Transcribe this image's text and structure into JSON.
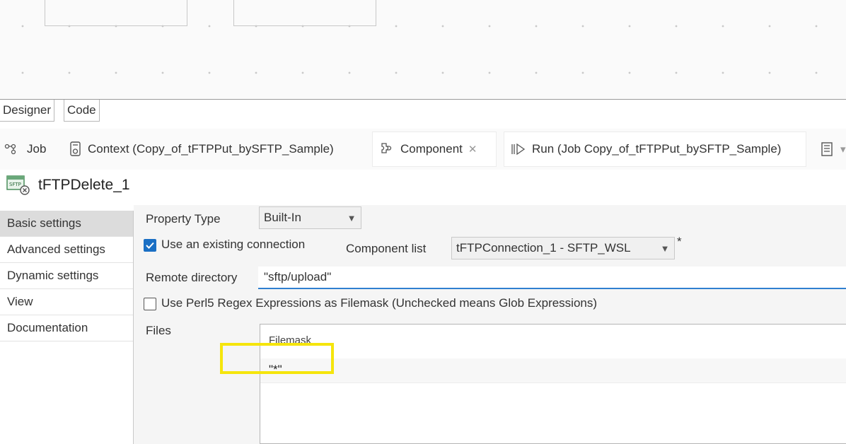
{
  "editor_tabs": {
    "designer": "Designer",
    "code": "Code"
  },
  "view_tabs": [
    {
      "label": "Job",
      "icon": "job-icon"
    },
    {
      "label": "Context (Copy_of_tFTPPut_bySFTP_Sample)",
      "icon": "context-icon"
    },
    {
      "label": "Component",
      "icon": "component-icon",
      "active": true
    },
    {
      "label": "Run (Job Copy_of_tFTPPut_bySFTP_Sample)",
      "icon": "run-icon"
    }
  ],
  "component": {
    "title": "tFTPDelete_1",
    "icon": "sftp-component-icon"
  },
  "nav_items": [
    "Basic settings",
    "Advanced settings",
    "Dynamic settings",
    "View",
    "Documentation"
  ],
  "form": {
    "property_type_label": "Property Type",
    "property_type_value": "Built-In",
    "use_existing_label": "Use an existing connection",
    "use_existing_checked": true,
    "component_list_label": "Component list",
    "component_list_value": "tFTPConnection_1 - SFTP_WSL",
    "component_list_marker": "*",
    "remote_dir_label": "Remote directory",
    "remote_dir_value": "\"sftp/upload\"",
    "perl_regex_label": "Use Perl5 Regex Expressions as Filemask (Unchecked means Glob Expressions)",
    "perl_regex_checked": false,
    "files_label": "Files",
    "files_table": {
      "header": "Filemask",
      "rows": [
        "\"*\""
      ]
    }
  },
  "colors": {
    "accent": "#1a6fc4",
    "highlight": "#f5e50c"
  }
}
